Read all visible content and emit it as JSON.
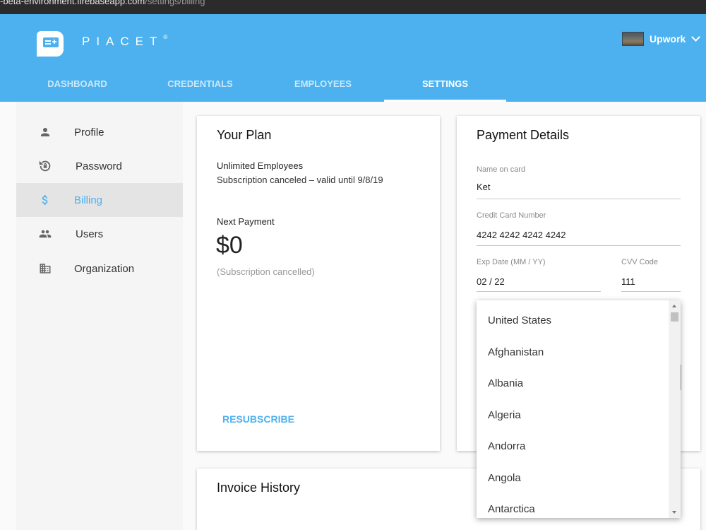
{
  "browser": {
    "url_host": "-beta-environment.firebaseapp.com",
    "url_path": "/settings/billing"
  },
  "header": {
    "brand": "PIACET",
    "brand_mark": "®",
    "user_name": "Upwork",
    "tabs": [
      {
        "label": "DASHBOARD"
      },
      {
        "label": "CREDENTIALS"
      },
      {
        "label": "EMPLOYEES"
      },
      {
        "label": "SETTINGS"
      }
    ],
    "active_tab": "SETTINGS",
    "colors": {
      "primary": "#4db1ef"
    }
  },
  "sidebar": {
    "items": [
      {
        "label": "Profile",
        "icon": "person-icon"
      },
      {
        "label": "Password",
        "icon": "lock-reset-icon"
      },
      {
        "label": "Billing",
        "icon": "dollar-icon"
      },
      {
        "label": "Users",
        "icon": "people-icon"
      },
      {
        "label": "Organization",
        "icon": "building-icon"
      }
    ],
    "active": "Billing"
  },
  "plan": {
    "title": "Your Plan",
    "name": "Unlimited Employees",
    "status": "Subscription canceled – valid until 9/8/19",
    "next_label": "Next Payment",
    "amount": "$0",
    "amount_note": "(Subscription cancelled)",
    "resubscribe": "RESUBSCRIBE"
  },
  "payment": {
    "title": "Payment Details",
    "name_label": "Name on card",
    "name_value": "Ket",
    "cc_label": "Credit Card Number",
    "cc_value": "4242 4242 4242 4242",
    "exp_label": "Exp Date (MM / YY)",
    "exp_value": "02 / 22",
    "cvv_label": "CVV Code",
    "cvv_value": "111"
  },
  "country_dropdown": {
    "options": [
      "United States",
      "Afghanistan",
      "Albania",
      "Algeria",
      "Andorra",
      "Angola",
      "Antarctica"
    ]
  },
  "invoice": {
    "title": "Invoice History"
  }
}
